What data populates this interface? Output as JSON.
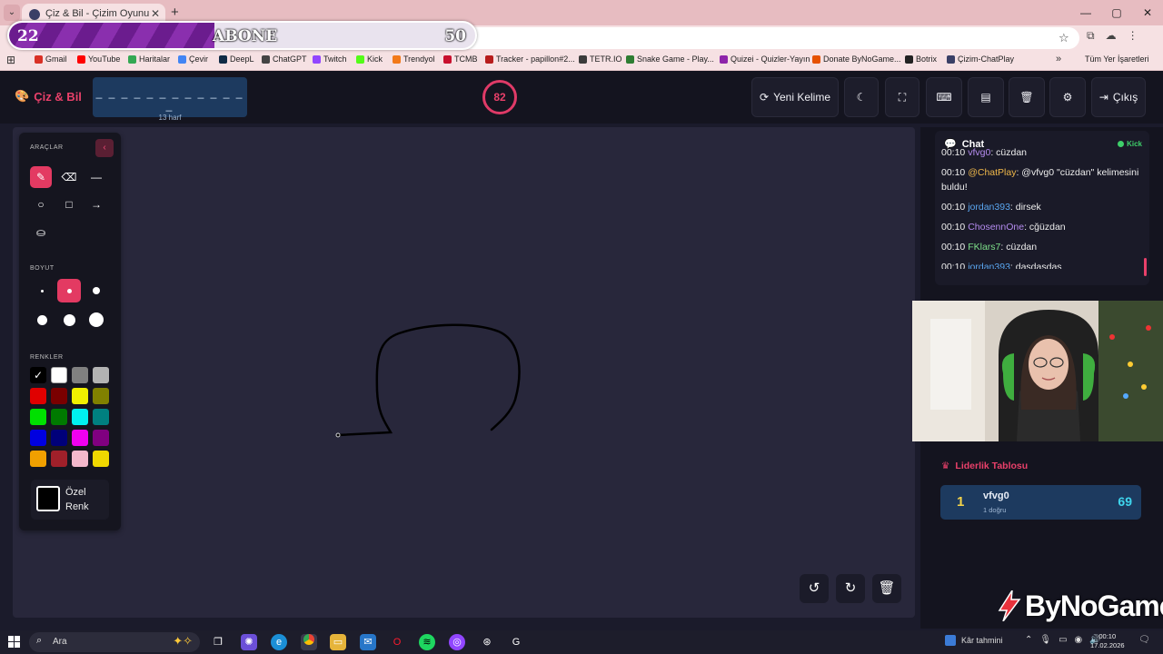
{
  "browser": {
    "tab_title": "Çiz & Bil - Çizim Oyunu",
    "new_tab_label": "+",
    "window_controls": [
      "—",
      "▢",
      "✕"
    ],
    "bookmarks": [
      {
        "label": "Gmail",
        "color": "#d93025"
      },
      {
        "label": "YouTube",
        "color": "#ff0000"
      },
      {
        "label": "Haritalar",
        "color": "#34a853"
      },
      {
        "label": "Çevir",
        "color": "#4285f4"
      },
      {
        "label": "DeepL",
        "color": "#0f2b46"
      },
      {
        "label": "ChatGPT",
        "color": "#444444"
      },
      {
        "label": "Twitch",
        "color": "#9146ff"
      },
      {
        "label": "Kick",
        "color": "#53fc18"
      },
      {
        "label": "Trendyol",
        "color": "#f27a1a"
      },
      {
        "label": "TCMB",
        "color": "#c8102e"
      },
      {
        "label": "Tracker - papillon#2...",
        "color": "#b71c1c"
      },
      {
        "label": "TETR.IO",
        "color": "#3b3b3b"
      },
      {
        "label": "Snake Game - Play...",
        "color": "#2e7d32"
      },
      {
        "label": "Quizei - Quizler-Yayın",
        "color": "#8e24aa"
      },
      {
        "label": "Donate ByNoGame...",
        "color": "#e65100"
      },
      {
        "label": "Botrix",
        "color": "#222222"
      },
      {
        "label": "Çizim-ChatPlay",
        "color": "#3a3f66"
      }
    ],
    "bookmarks_more": "»",
    "all_bookmarks": "Tüm Yer İşaretleri"
  },
  "sub_goal": {
    "current": "22",
    "label": "ABONE",
    "goal": "50",
    "progress": 0.44
  },
  "app": {
    "logo": "Çiz & Bil",
    "word_blanks": "_ _ _ _ _ _ _ _ _ _ _ _ _",
    "word_length": "13 harf",
    "timer": "82",
    "buttons": {
      "new_word": "Yeni Kelime",
      "exit": "Çıkış"
    }
  },
  "tools": {
    "heading": "ARAÇLAR",
    "size_heading": "BOYUT",
    "colors_heading": "RENKLER",
    "custom_color_label": "Özel Renk",
    "colors": [
      "#000000",
      "#ffffff",
      "#808080",
      "#b3b3b3",
      "#e00000",
      "#7a0000",
      "#f0f000",
      "#808000",
      "#00e000",
      "#007a00",
      "#00f0f0",
      "#008080",
      "#0000e0",
      "#00007a",
      "#f000f0",
      "#800080",
      "#f0a000",
      "#a0202a",
      "#f4b8cc",
      "#f0d800"
    ]
  },
  "chat": {
    "title": "Chat",
    "status": "Kick",
    "messages": [
      {
        "time": "00:10",
        "user": "vfvg0",
        "color": "#b58cf0",
        "text": ": cüzdan"
      },
      {
        "time": "00:10",
        "user": "@ChatPlay",
        "color": "#f0b84a",
        "text": ": @vfvg0 \"cüzdan\" kelimesini buldu!"
      },
      {
        "time": "00:10",
        "user": "jordan393",
        "color": "#5aa6f0",
        "text": ": dirsek"
      },
      {
        "time": "00:10",
        "user": "ChosennOne",
        "color": "#b58cf0",
        "text": ": cğüzdan"
      },
      {
        "time": "00:10",
        "user": "FKlars7",
        "color": "#7ee08a",
        "text": ": cüzdan"
      },
      {
        "time": "00:10",
        "user": "jordan393",
        "color": "#5aa6f0",
        "text": ": dasdasdas"
      }
    ]
  },
  "leaderboard": {
    "title": "Liderlik Tablosu",
    "entries": [
      {
        "rank": "1",
        "name": "vfvg0",
        "sub": "1 doğru",
        "score": "69"
      }
    ]
  },
  "watermark": "ByNoGame",
  "taskbar": {
    "search_label": "Ara",
    "weather": "Kâr tahmini",
    "time": "00:10",
    "date": "17.02.2026"
  }
}
